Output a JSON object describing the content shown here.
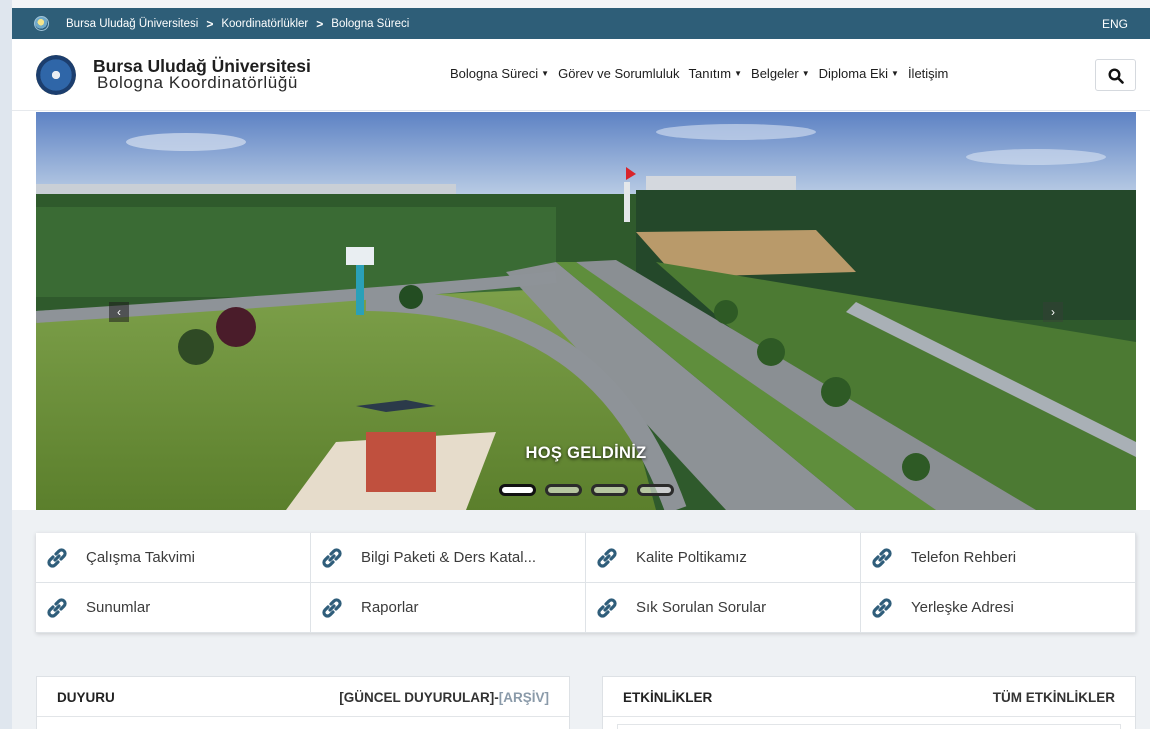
{
  "topbar": {
    "crumbs": [
      "Bursa Uludağ Üniversitesi",
      "Koordinatörlükler",
      "Bologna Süreci"
    ],
    "separator": ">",
    "lang": "ENG"
  },
  "header": {
    "brand_line1": "Bursa Uludağ Üniversitesi",
    "brand_line2": "Bologna Koordinatörlüğü",
    "nav": [
      {
        "label": "Bologna Süreci",
        "dropdown": true
      },
      {
        "label": "Görev ve Sorumluluk",
        "dropdown": false
      },
      {
        "label": "Tanıtım",
        "dropdown": true
      },
      {
        "label": "Belgeler",
        "dropdown": true
      },
      {
        "label": "Diploma Eki",
        "dropdown": true
      },
      {
        "label": "İletişim",
        "dropdown": false
      }
    ],
    "caret": "▼",
    "search_icon": "search-icon"
  },
  "hero": {
    "caption": "HOŞ GELDİNİZ",
    "prev_icon": "‹",
    "next_icon": "›",
    "slide_count": 4,
    "active_slide": 1
  },
  "quick_links": [
    "Çalışma Takvimi",
    "Bilgi Paketi & Ders Katal...",
    "Kalite Poltikamız",
    "Telefon Rehberi",
    "Sunumlar",
    "Raporlar",
    "Sık Sorulan Sorular",
    "Yerleşke Adresi"
  ],
  "panels": {
    "announcements": {
      "title": "DUYURU",
      "current": "[GÜNCEL DUYURULAR]-",
      "archive": "[ARŞİV]"
    },
    "events": {
      "title": "ETKİNLİKLER",
      "all": "TÜM ETKİNLİKLER"
    }
  },
  "colors": {
    "topbar": "#2e5e78",
    "link_icon": "#2f5d7a",
    "archive": "#8a9aa9"
  }
}
